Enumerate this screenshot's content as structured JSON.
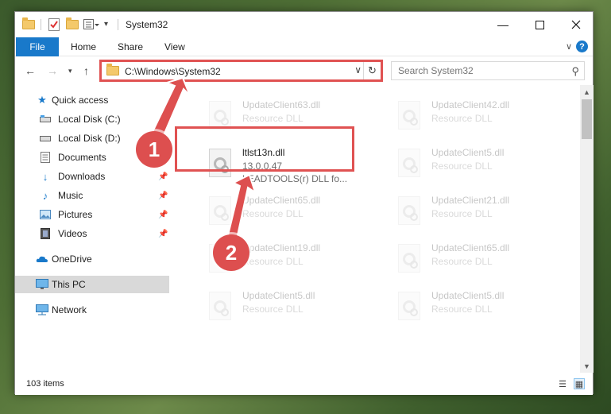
{
  "window": {
    "title": "System32"
  },
  "ribbon": {
    "tabs": [
      "File",
      "Home",
      "Share",
      "View"
    ]
  },
  "address_bar": {
    "path": "C:\\Windows\\System32"
  },
  "search": {
    "placeholder": "Search System32"
  },
  "sidebar": {
    "items": [
      {
        "label": "Quick access",
        "icon": "star-icon"
      },
      {
        "label": "Local Disk (C:)",
        "icon": "drive-icon"
      },
      {
        "label": "Local Disk (D:)",
        "icon": "drive-icon"
      },
      {
        "label": "Documents",
        "icon": "documents-icon"
      },
      {
        "label": "Downloads",
        "icon": "downloads-icon"
      },
      {
        "label": "Music",
        "icon": "music-icon"
      },
      {
        "label": "Pictures",
        "icon": "pictures-icon"
      },
      {
        "label": "Videos",
        "icon": "videos-icon"
      },
      {
        "label": "OneDrive",
        "icon": "cloud-icon"
      },
      {
        "label": "This PC",
        "icon": "computer-icon",
        "selected": true
      },
      {
        "label": "Network",
        "icon": "network-icon"
      }
    ]
  },
  "files": [
    {
      "name": "UpdateClient63.dll",
      "type": "Resource DLL"
    },
    {
      "name": "UpdateClient42.dll",
      "type": "Resource DLL"
    },
    {
      "name": "ltlst13n.dll",
      "version": "13.0.0.47",
      "description": "LEADTOOLS(r) DLL fo..."
    },
    {
      "name": "UpdateClient5.dll",
      "type": "Resource DLL"
    },
    {
      "name": "UpdateClient65.dll",
      "type": "Resource DLL"
    },
    {
      "name": "UpdateClient21.dll",
      "type": "Resource DLL"
    },
    {
      "name": "UpdateClient19.dll",
      "type": "Resource DLL"
    },
    {
      "name": "UpdateClient65.dll",
      "type": "Resource DLL"
    },
    {
      "name": "UpdateClient5.dll",
      "type": "Resource DLL"
    },
    {
      "name": "UpdateClient5.dll",
      "type": "Resource DLL"
    }
  ],
  "status": {
    "item_count": "103 items"
  },
  "callouts": [
    "1",
    "2"
  ],
  "colors": {
    "accent": "#1979ca",
    "highlight": "#e05252",
    "callout": "#dd4f4f"
  }
}
